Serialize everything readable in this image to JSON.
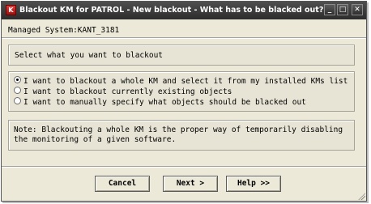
{
  "window": {
    "title": "Blackout KM for PATROL - New blackout - What has to be blacked out?",
    "icon_glyph": "K",
    "minimize_glyph": "_",
    "maximize_glyph": "□",
    "close_glyph": "✕"
  },
  "managed_system": "Managed System:KANT_3181",
  "prompt": "Select what you want to blackout",
  "options": [
    {
      "label": "I want to blackout a whole KM and select it from my installed KMs list",
      "selected": true
    },
    {
      "label": "I want to blackout currently existing objects",
      "selected": false
    },
    {
      "label": "I want to manually specify what objects should be blacked out",
      "selected": false
    }
  ],
  "note": "Note: Blackouting a whole KM is the proper way of temporarily disabling\nthe monitoring of a given software.",
  "buttons": {
    "cancel": "Cancel",
    "next": "Next >",
    "help": "Help >>"
  },
  "colors": {
    "titlebar": "#2c2c2c",
    "dialog_bg": "#ece9d8",
    "panel_bg": "#e7e4d6"
  }
}
